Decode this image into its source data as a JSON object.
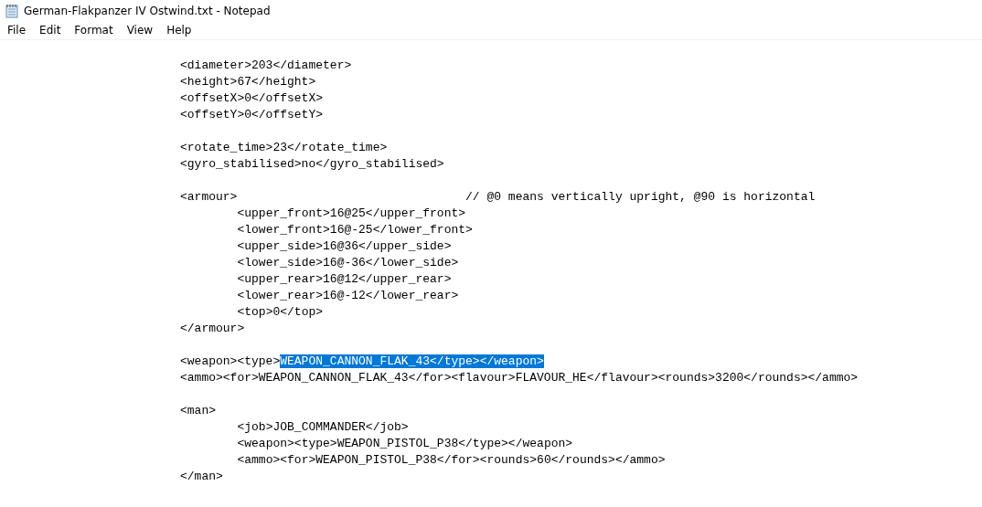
{
  "window": {
    "title": "German-Flakpanzer IV Ostwind.txt - Notepad"
  },
  "menu": [
    {
      "label": "File"
    },
    {
      "label": "Edit"
    },
    {
      "label": "Format"
    },
    {
      "label": "View"
    },
    {
      "label": "Help"
    }
  ],
  "lines": [
    {
      "kind": "text",
      "text": "<diameter>203</diameter>"
    },
    {
      "kind": "text",
      "text": "<height>67</height>"
    },
    {
      "kind": "text",
      "text": "<offsetX>0</offsetX>"
    },
    {
      "kind": "text",
      "text": "<offsetY>0</offsetY>"
    },
    {
      "kind": "blank"
    },
    {
      "kind": "text",
      "text": "<rotate_time>23</rotate_time>"
    },
    {
      "kind": "text",
      "text": "<gyro_stabilised>no</gyro_stabilised>"
    },
    {
      "kind": "blank"
    },
    {
      "kind": "text",
      "text": "<armour>\t\t\t\t// @0 means vertically upright, @90 is horizontal"
    },
    {
      "kind": "text",
      "text": "\t<upper_front>16@25</upper_front>"
    },
    {
      "kind": "text",
      "text": "\t<lower_front>16@-25</lower_front>"
    },
    {
      "kind": "text",
      "text": "\t<upper_side>16@36</upper_side>"
    },
    {
      "kind": "text",
      "text": "\t<lower_side>16@-36</lower_side>"
    },
    {
      "kind": "text",
      "text": "\t<upper_rear>16@12</upper_rear>"
    },
    {
      "kind": "text",
      "text": "\t<lower_rear>16@-12</lower_rear>"
    },
    {
      "kind": "text",
      "text": "\t<top>0</top>"
    },
    {
      "kind": "text",
      "text": "</armour>"
    },
    {
      "kind": "blank"
    },
    {
      "kind": "parts",
      "parts": [
        {
          "text": "<weapon><type>",
          "selected": false
        },
        {
          "text": "WEAPON_CANNON_FLAK_43</type></weapon>",
          "selected": true
        }
      ]
    },
    {
      "kind": "text",
      "text": "<ammo><for>WEAPON_CANNON_FLAK_43</for><flavour>FLAVOUR_HE</flavour><rounds>3200</rounds></ammo>"
    },
    {
      "kind": "blank"
    },
    {
      "kind": "text",
      "text": "<man>"
    },
    {
      "kind": "text",
      "text": "\t<job>JOB_COMMANDER</job>"
    },
    {
      "kind": "text",
      "text": "\t<weapon><type>WEAPON_PISTOL_P38</type></weapon>"
    },
    {
      "kind": "text",
      "text": "\t<ammo><for>WEAPON_PISTOL_P38</for><rounds>60</rounds></ammo>"
    },
    {
      "kind": "text",
      "text": "</man>"
    }
  ]
}
